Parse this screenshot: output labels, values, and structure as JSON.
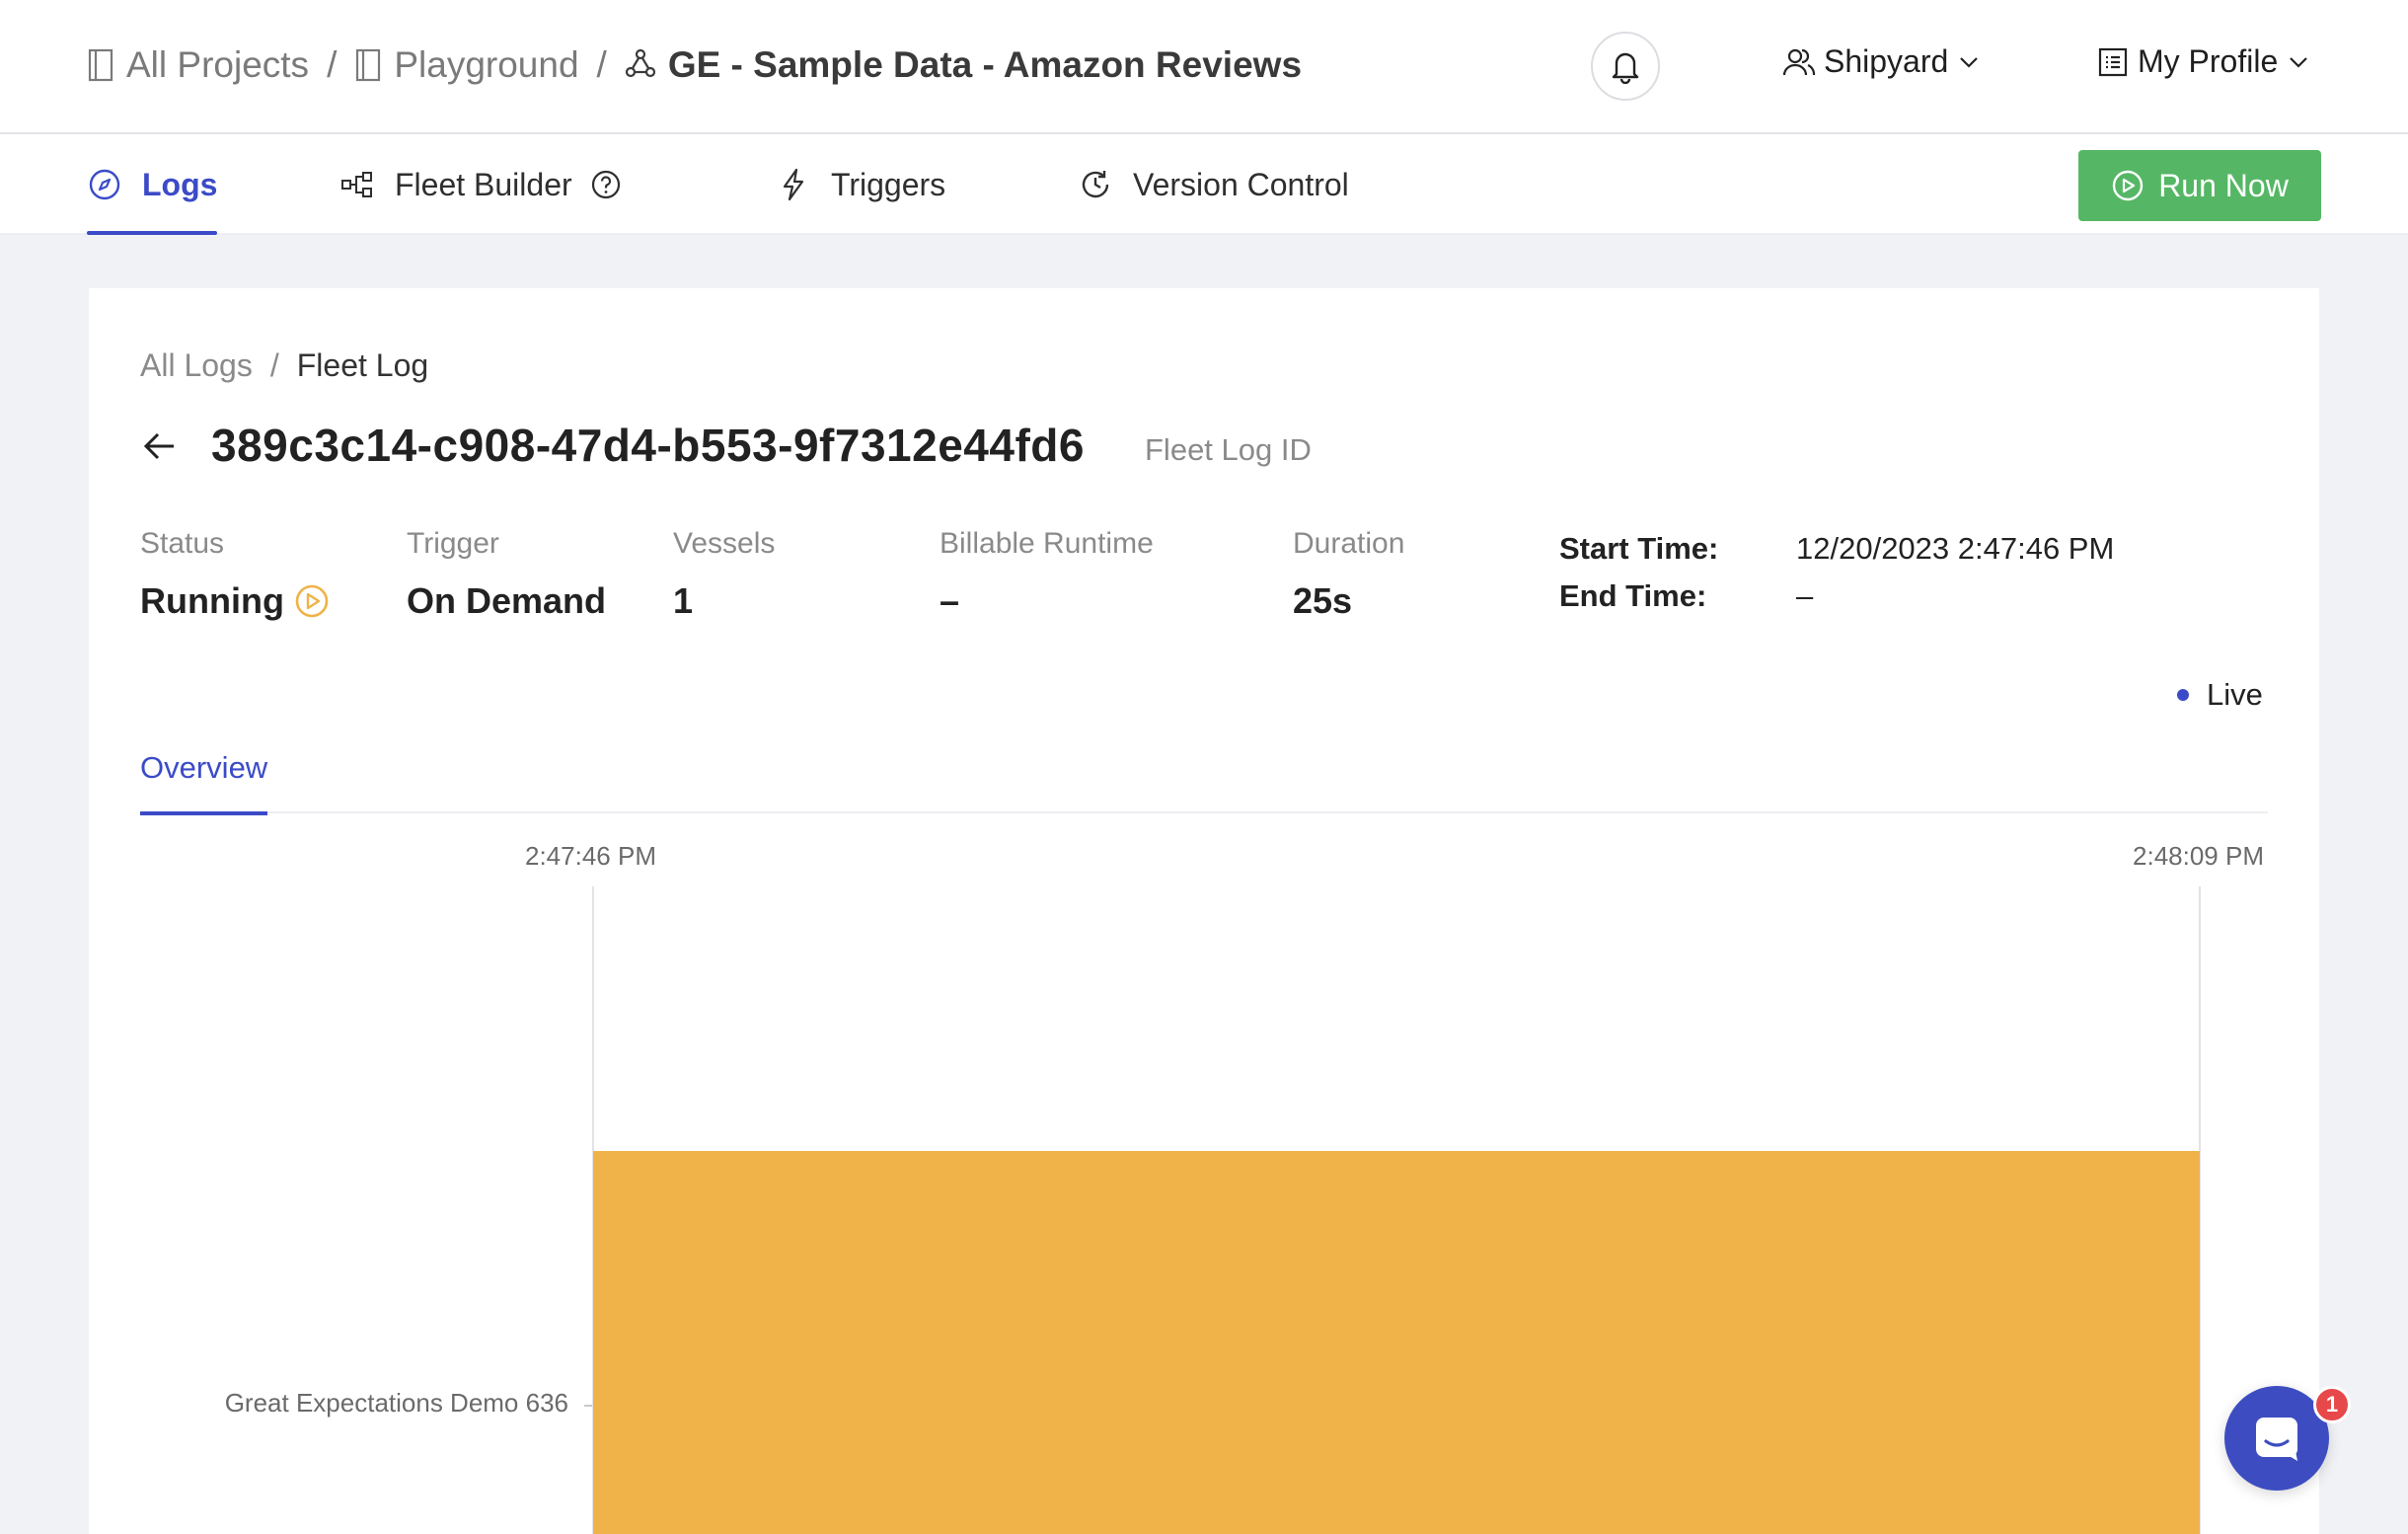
{
  "breadcrumb": {
    "items": [
      {
        "label": "All Projects",
        "icon": "folder-icon"
      },
      {
        "label": "Playground",
        "icon": "folder-icon"
      },
      {
        "label": "GE - Sample Data - Amazon Reviews",
        "icon": "fleet-icon"
      }
    ],
    "separator": "/"
  },
  "header": {
    "org_menu_label": "Shipyard",
    "profile_menu_label": "My Profile"
  },
  "tabs": [
    {
      "label": "Logs",
      "icon": "compass-icon",
      "active": true
    },
    {
      "label": "Fleet Builder",
      "icon": "fleet-builder-icon",
      "active": false
    },
    {
      "label": "Triggers",
      "icon": "lightning-icon",
      "active": false
    },
    {
      "label": "Version Control",
      "icon": "history-icon",
      "active": false
    }
  ],
  "run_button": {
    "label": "Run Now",
    "color": "#55b765"
  },
  "sub_breadcrumb": {
    "items": [
      "All Logs",
      "Fleet Log"
    ],
    "separator": "/"
  },
  "fleet_log": {
    "id": "389c3c14-c908-47d4-b553-9f7312e44fd6",
    "id_label": "Fleet Log ID"
  },
  "meta": {
    "status": {
      "label": "Status",
      "value": "Running",
      "color": "#efb349"
    },
    "trigger": {
      "label": "Trigger",
      "value": "On Demand"
    },
    "vessels": {
      "label": "Vessels",
      "value": "1"
    },
    "billable_runtime": {
      "label": "Billable Runtime",
      "value": "–"
    },
    "duration": {
      "label": "Duration",
      "value": "25s"
    },
    "start_time": {
      "label": "Start Time:",
      "value": "12/20/2023 2:47:46 PM"
    },
    "end_time": {
      "label": "End Time:",
      "value": "–"
    }
  },
  "live_label": "Live",
  "overview_tab": "Overview",
  "timeline": {
    "start_label": "2:47:46 PM",
    "end_label": "2:48:09 PM",
    "rows": [
      {
        "label": "Great Expectations Demo 636",
        "bar_color": "#efb349"
      }
    ]
  },
  "chat": {
    "badge_count": "1",
    "color": "#3d4dc1"
  }
}
